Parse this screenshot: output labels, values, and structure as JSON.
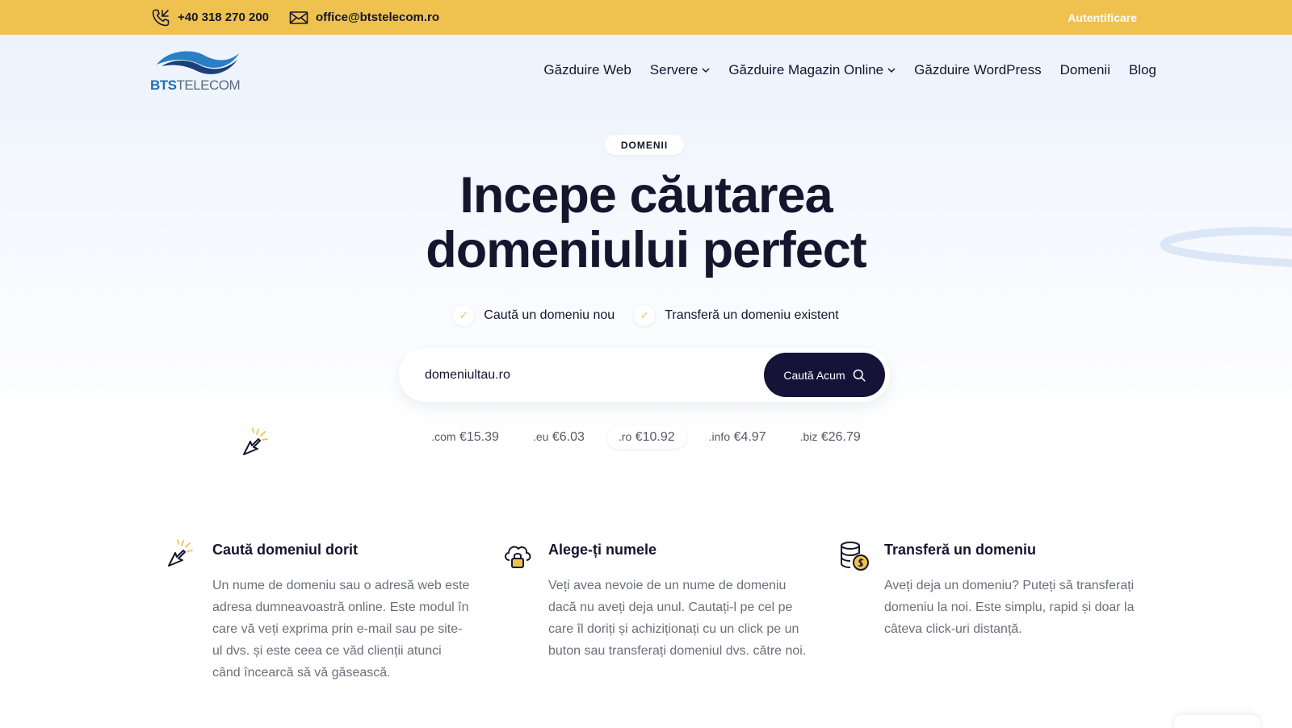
{
  "topbar": {
    "phone": "+40 318 270 200",
    "email": "office@btstelecom.ro",
    "login": "Autentificare",
    "phone_icon": "phone-icon",
    "mail_icon": "mail-icon"
  },
  "logo": {
    "part1": "BTS",
    "part2": "TELECOM"
  },
  "nav": {
    "items": [
      {
        "label": "Găzduire Web"
      },
      {
        "label": "Servere"
      },
      {
        "label": "Găzduire Magazin Online"
      },
      {
        "label": "Găzduire WordPress"
      },
      {
        "label": "Domenii"
      },
      {
        "label": "Blog"
      }
    ]
  },
  "hero": {
    "badge": "DOMENII",
    "title_line1": "Incepe căutarea",
    "title_line2": "domeniului perfect",
    "checks": [
      {
        "label": "Caută un domeniu nou"
      },
      {
        "label": "Transferă un domeniu existent"
      }
    ]
  },
  "search": {
    "placeholder": "domeniultau.ro",
    "button": "Caută Acum",
    "button_icon": "search-icon"
  },
  "prices": [
    {
      "tld": ".com",
      "price": "€15.39"
    },
    {
      "tld": ".eu",
      "price": "€6.03"
    },
    {
      "tld": ".ro",
      "price": "€10.92",
      "selected": true
    },
    {
      "tld": ".info",
      "price": "€4.97"
    },
    {
      "tld": ".biz",
      "price": "€26.79"
    }
  ],
  "features": [
    {
      "icon": "cursor-click-icon",
      "title": "Caută domeniul dorit",
      "text": "Un nume de domeniu sau o adresă web este adresa dumneavoastră online. Este modul în care vă veți exprima prin e-mail sau pe site-ul dvs. și este ceea ce văd clienții atunci când încearcă să vă găsească."
    },
    {
      "icon": "cloud-lock-icon",
      "title": "Alege-ți numele",
      "text": "Veți avea nevoie de un nume de domeniu dacă nu aveți deja unul. Cautați-l pe cel pe care îl doriți și achiziționați cu un click pe un buton sau transferați domeniul dvs. către noi."
    },
    {
      "icon": "database-coin-icon",
      "title": "Transferă un domeniu",
      "text": "Aveți deja un domeniu? Puteți să transferați domeniu la noi. Este simplu, rapid și doar la câteva click-uri distanță."
    }
  ],
  "colors": {
    "topbar": "#efc14f",
    "dark": "#14162e",
    "button": "#151438",
    "accent": "#efc14f",
    "logo_blue": "#1e6fb5"
  }
}
